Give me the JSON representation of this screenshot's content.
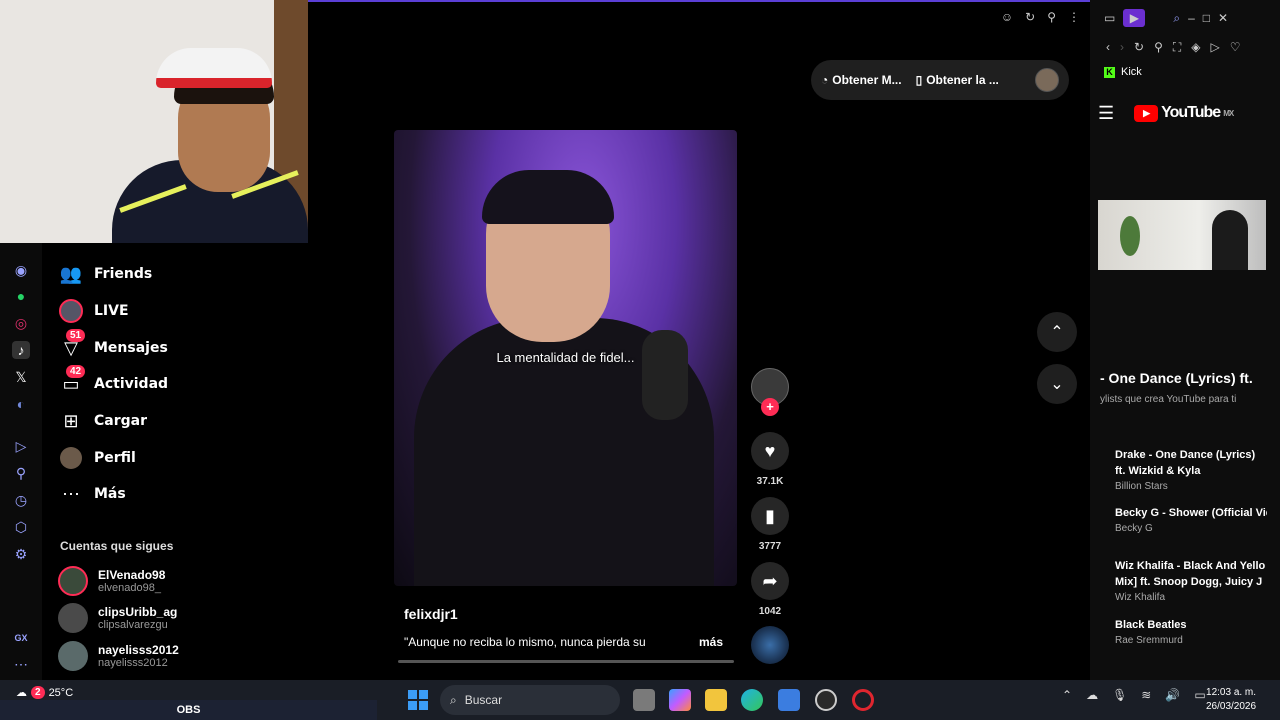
{
  "weather": {
    "temp": "25°C",
    "alert_count": "2"
  },
  "obs_label": "OBS",
  "tiktok_nav": {
    "items": [
      {
        "label": "Friends",
        "icon": "friends-icon"
      },
      {
        "label": "LIVE",
        "icon": "live-icon"
      },
      {
        "label": "Mensajes",
        "icon": "messages-icon",
        "badge": "51"
      },
      {
        "label": "Actividad",
        "icon": "activity-icon",
        "badge": "42"
      },
      {
        "label": "Cargar",
        "icon": "upload-icon"
      },
      {
        "label": "Perfil",
        "icon": "profile-icon"
      },
      {
        "label": "Más",
        "icon": "more-icon"
      }
    ],
    "following_title": "Cuentas que sigues",
    "following": [
      {
        "name": "ElVenado98",
        "handle": "elvenado98_"
      },
      {
        "name": "clipsUribb_ag",
        "handle": "clipsalvarezgu"
      },
      {
        "name": "nayelisss2012",
        "handle": "nayelisss2012"
      }
    ]
  },
  "obtain_bar": {
    "btn1": "Obtener M...",
    "btn2": "Obtener la ..."
  },
  "video": {
    "caption": "La mentalidad de fidel...",
    "author": "felixdjr1",
    "description": "\"Aunque no reciba lo mismo, nunca pierda su",
    "more": "más",
    "likes": "37.1K",
    "saves": "3777",
    "shares": "1042"
  },
  "right_panel": {
    "kick_label": "Kick",
    "yt_logo": "YouTube",
    "yt_region": "MX",
    "playlist_title": "- One Dance (Lyrics) ft.",
    "playlist_sub": "ylists que crea YouTube para ti",
    "items": [
      {
        "title": "Drake - One Dance (Lyrics) ft. Wizkid & Kyla",
        "artist": "Billion Stars"
      },
      {
        "title": "Becky G - Shower (Official Vic",
        "artist": "Becky G"
      },
      {
        "title": "Wiz Khalifa - Black And Yello Mix] ft. Snoop Dogg, Juicy J &",
        "artist": "Wiz Khalifa"
      },
      {
        "title": "Black Beatles",
        "artist": "Rae Sremmurd"
      }
    ]
  },
  "taskbar": {
    "search_placeholder": "Buscar"
  },
  "clock": {
    "time": "12:03 a. m.",
    "date": "26/03/2026"
  },
  "colors": {
    "accent": "#5b3fd6",
    "tiktok_red": "#fe2c55",
    "yt_red": "#ff0000",
    "kick_green": "#53fc18"
  }
}
